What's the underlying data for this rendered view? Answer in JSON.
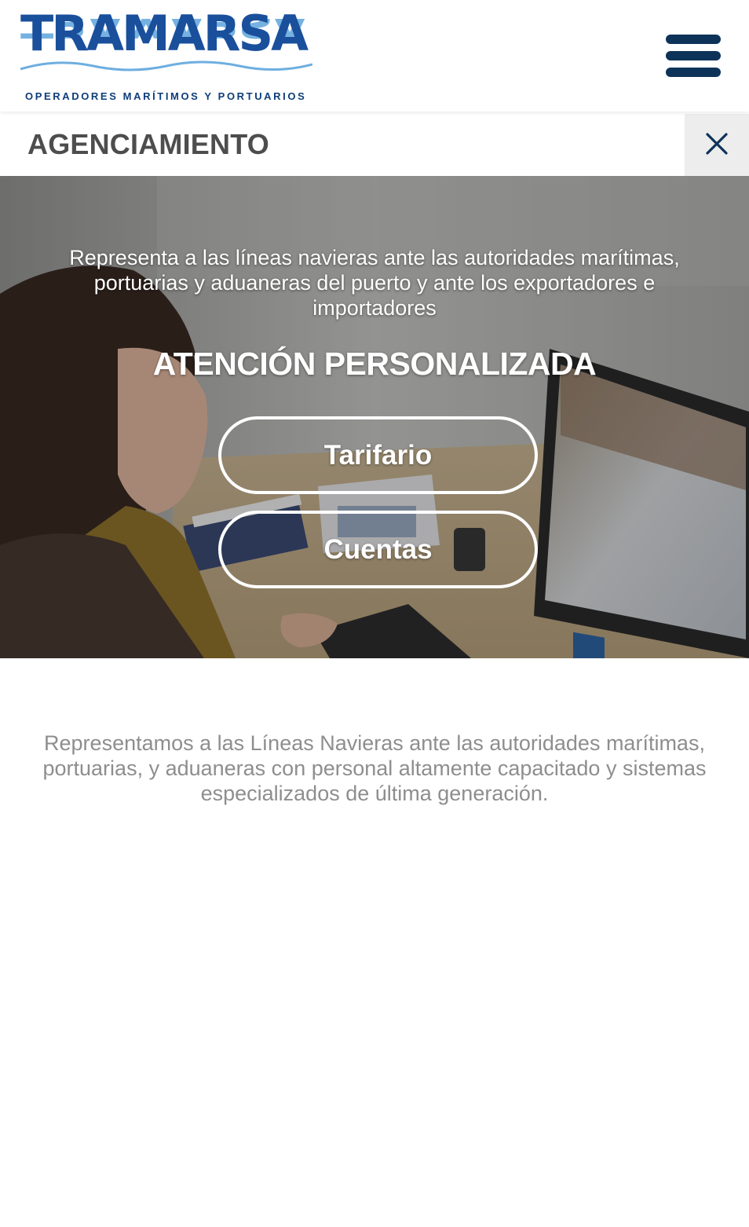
{
  "header": {
    "logo_text": "TRAMARSA",
    "logo_tagline": "OPERADORES MARÍTIMOS Y PORTUARIOS",
    "menu_icon": "hamburger-menu-icon"
  },
  "section": {
    "title": "AGENCIAMIENTO",
    "close_icon": "close-icon"
  },
  "hero": {
    "text": "Representa a las líneas navieras ante las autoridades marítimas, portuarias y aduaneras del puerto y ante los exportadores e importadores",
    "heading": "ATENCIÓN PERSONALIZADA",
    "buttons": [
      {
        "label": "Tarifario"
      },
      {
        "label": "Cuentas"
      }
    ]
  },
  "body": {
    "description": "Representamos a las Líneas Navieras ante las autoridades marítimas, portuarias, y aduaneras con personal altamente capacitado y sistemas especializados de última generación."
  },
  "colors": {
    "brand_dark_blue": "#0e3359",
    "brand_blue": "#1a4f9c",
    "brand_light_blue": "#6eaee0",
    "section_title_gray": "#4d4d4d",
    "description_gray": "#8e8e8e"
  }
}
